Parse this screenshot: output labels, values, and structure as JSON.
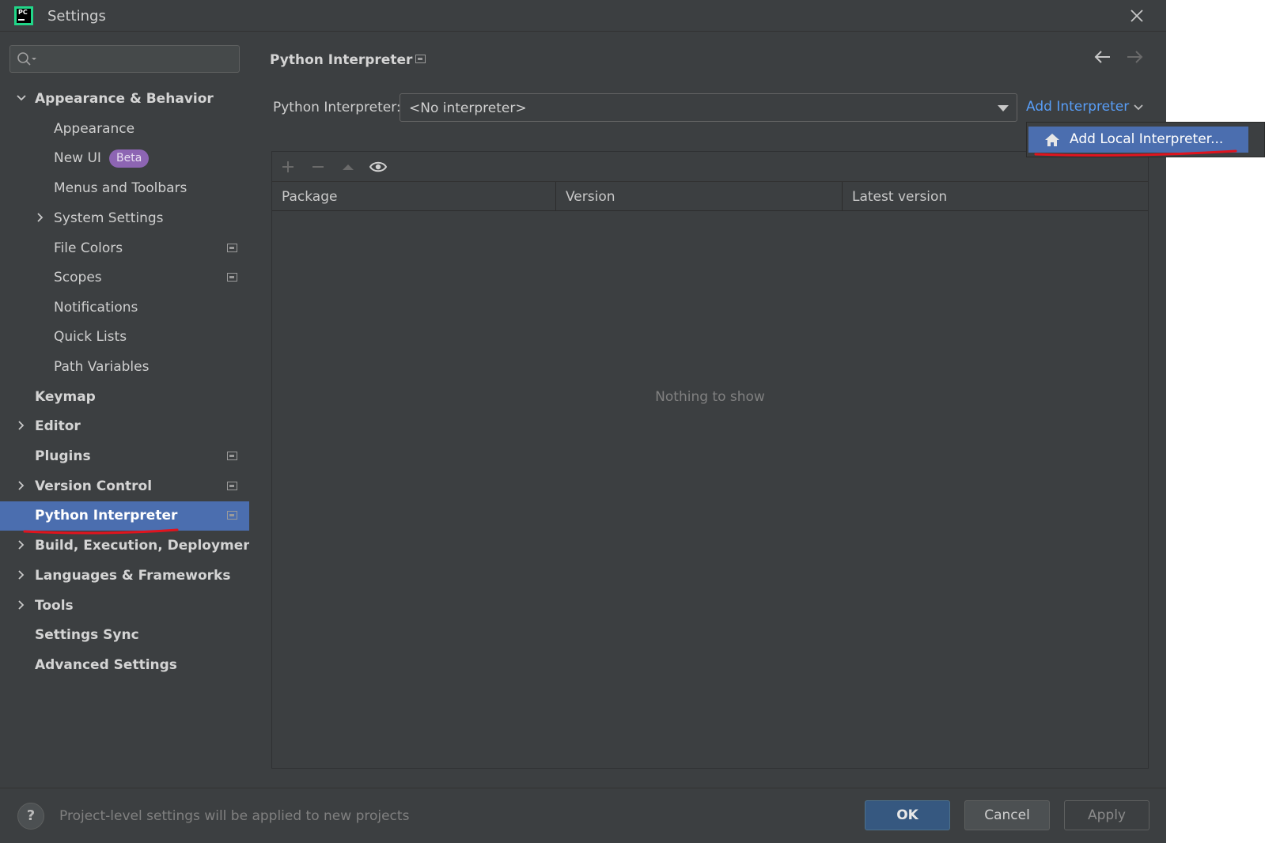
{
  "window": {
    "title": "Settings",
    "logo_text": "PC"
  },
  "search": {
    "value": "",
    "placeholder": ""
  },
  "sidebar": {
    "items": [
      {
        "label": "Appearance & Behavior",
        "level": 0,
        "bold": true,
        "expanded": true
      },
      {
        "label": "Appearance",
        "level": 1
      },
      {
        "label": "New UI",
        "level": 1,
        "badge": "Beta"
      },
      {
        "label": "Menus and Toolbars",
        "level": 1
      },
      {
        "label": "System Settings",
        "level": 1,
        "collapsed": true
      },
      {
        "label": "File Colors",
        "level": 1,
        "project_icon": true
      },
      {
        "label": "Scopes",
        "level": 1,
        "project_icon": true
      },
      {
        "label": "Notifications",
        "level": 1
      },
      {
        "label": "Quick Lists",
        "level": 1
      },
      {
        "label": "Path Variables",
        "level": 1
      },
      {
        "label": "Keymap",
        "level": 0,
        "bold": true
      },
      {
        "label": "Editor",
        "level": 0,
        "bold": true,
        "collapsed": true
      },
      {
        "label": "Plugins",
        "level": 0,
        "bold": true,
        "project_icon": true
      },
      {
        "label": "Version Control",
        "level": 0,
        "bold": true,
        "collapsed": true,
        "project_icon": true
      },
      {
        "label": "Python Interpreter",
        "level": 0,
        "bold": true,
        "selected": true,
        "project_icon": true
      },
      {
        "label": "Build, Execution, Deployment",
        "level": 0,
        "bold": true,
        "collapsed": true
      },
      {
        "label": "Languages & Frameworks",
        "level": 0,
        "bold": true,
        "collapsed": true
      },
      {
        "label": "Tools",
        "level": 0,
        "bold": true,
        "collapsed": true
      },
      {
        "label": "Settings Sync",
        "level": 0,
        "bold": true
      },
      {
        "label": "Advanced Settings",
        "level": 0,
        "bold": true
      }
    ]
  },
  "main": {
    "title": "Python Interpreter",
    "interpreter_label": "Python Interpreter:",
    "interpreter_value": "<No interpreter>",
    "add_interpreter": "Add Interpreter",
    "table": {
      "columns": [
        "Package",
        "Version",
        "Latest version"
      ],
      "rows": [],
      "empty_text": "Nothing to show"
    }
  },
  "popup": {
    "items": [
      {
        "label": "Add Local Interpreter...",
        "icon": "home-icon",
        "highlighted": true
      }
    ]
  },
  "footer": {
    "help": "?",
    "note": "Project-level settings will be applied to new projects",
    "ok": "OK",
    "cancel": "Cancel",
    "apply": "Apply"
  },
  "colors": {
    "background": "#3c3f41",
    "selection": "#4b6eaf",
    "link": "#589df6",
    "badge": "#8d65b3",
    "annotation": "#e0141e"
  }
}
